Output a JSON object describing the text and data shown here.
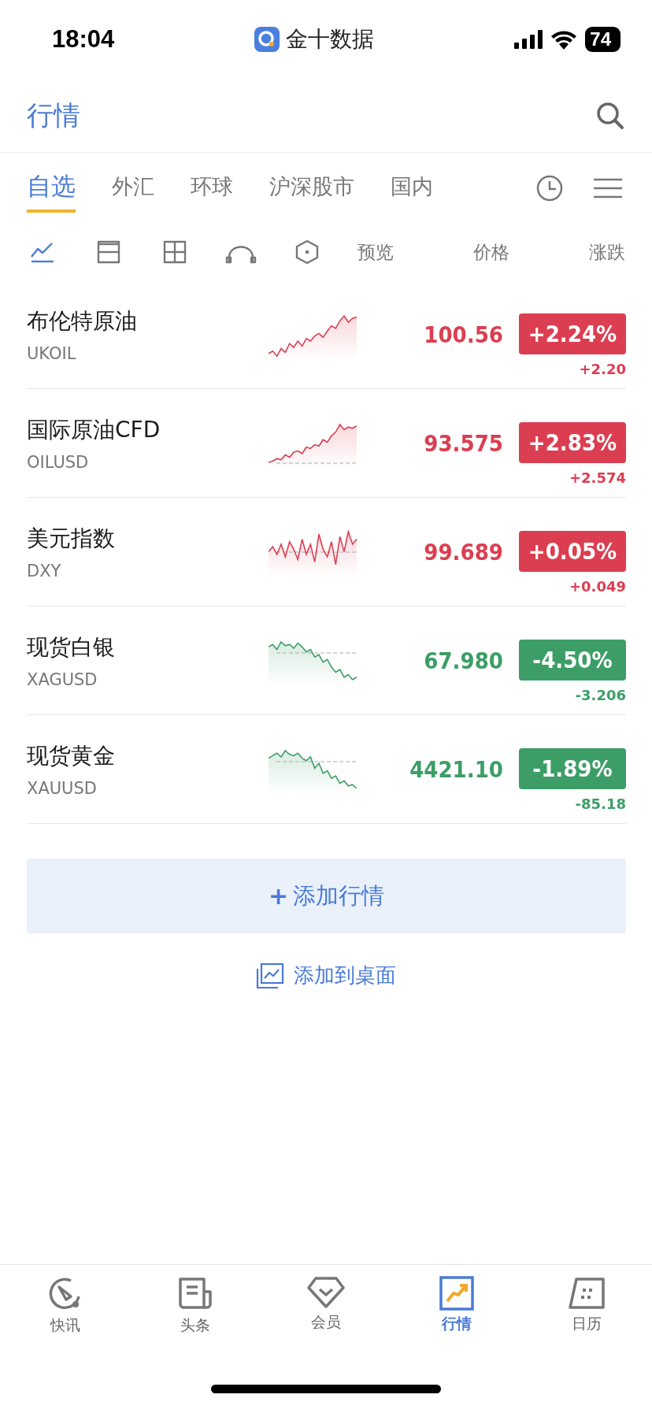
{
  "status_bar": {
    "time": "18:04",
    "app_name": "金十数据",
    "battery": "74"
  },
  "header": {
    "title": "行情"
  },
  "tabs": [
    {
      "label": "自选",
      "selected": true
    },
    {
      "label": "外汇",
      "selected": false
    },
    {
      "label": "环球",
      "selected": false
    },
    {
      "label": "沪深股市",
      "selected": false
    },
    {
      "label": "国内",
      "selected": false
    }
  ],
  "view_modes": [
    {
      "kind": "line",
      "selected": true
    },
    {
      "kind": "split",
      "selected": false
    },
    {
      "kind": "grid",
      "selected": false
    },
    {
      "kind": "arch",
      "selected": false
    },
    {
      "kind": "hexagon",
      "selected": false
    }
  ],
  "columns": [
    "预览",
    "价格",
    "涨跌"
  ],
  "quotes": [
    {
      "name": "布伦特原油",
      "symbol": "UKOIL",
      "rising": true,
      "price": "100.56",
      "change_pct": "+2.24%",
      "change": "+2.20"
    },
    {
      "name": "国际原油CFD",
      "symbol": "OILUSD",
      "rising": true,
      "price": "93.575",
      "change_pct": "+2.83%",
      "change": "+2.574"
    },
    {
      "name": "美元指数",
      "symbol": "DXY",
      "rising": true,
      "price": "99.689",
      "change_pct": "+0.05%",
      "change": "+0.049"
    },
    {
      "name": "现货白银",
      "symbol": "XAGUSD",
      "rising": false,
      "price": "67.980",
      "change_pct": "-4.50%",
      "change": "-3.206"
    },
    {
      "name": "现货黄金",
      "symbol": "XAUUSD",
      "rising": false,
      "price": "4421.10",
      "change_pct": "-1.89%",
      "change": "-85.18"
    }
  ],
  "add_button": {
    "icon": "+",
    "label": "添加行情"
  },
  "add_to_desktop": "添加到桌面",
  "bottom_nav": [
    {
      "kind": "flash",
      "label": "快讯",
      "selected": false
    },
    {
      "kind": "news",
      "label": "头条",
      "selected": false
    },
    {
      "kind": "member",
      "label": "会员",
      "selected": false
    },
    {
      "kind": "market",
      "label": "行情",
      "selected": true
    },
    {
      "kind": "calendar",
      "label": "日历",
      "selected": false
    }
  ]
}
